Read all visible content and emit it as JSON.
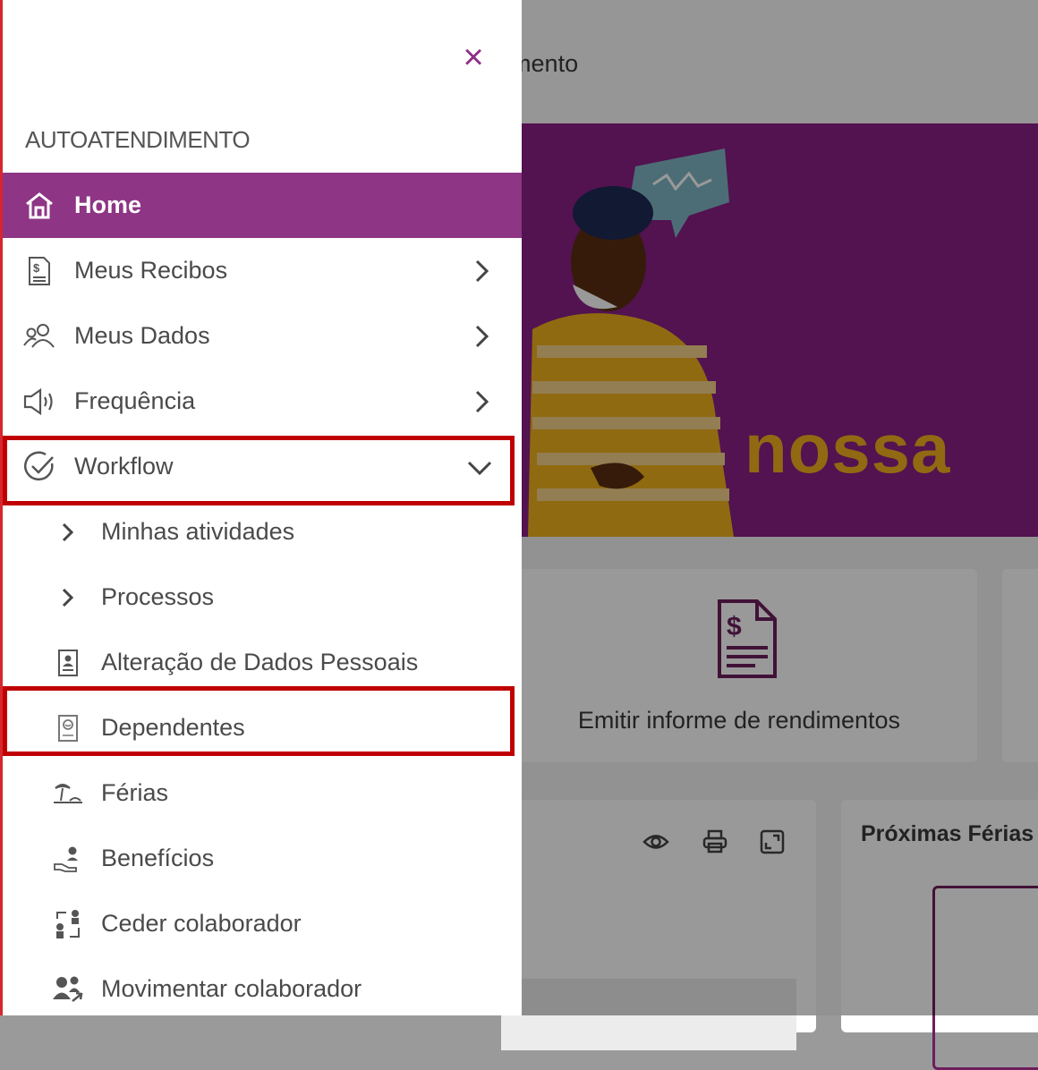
{
  "background": {
    "header_title": "endimento",
    "banner_text": "nossa",
    "card_label": "Emitir informe de rendimentos",
    "panel_title": "Próximas Férias",
    "tool_icons": [
      "eye-icon",
      "printer-icon",
      "expand-icon"
    ]
  },
  "drawer": {
    "close_label": "×",
    "section_title": "AUTOATENDIMENTO",
    "items": [
      {
        "label": "Home",
        "icon": "home-icon",
        "active": true
      },
      {
        "label": "Meus Recibos",
        "icon": "receipt-icon",
        "chevron": "right"
      },
      {
        "label": "Meus Dados",
        "icon": "people-icon",
        "chevron": "right"
      },
      {
        "label": "Frequência",
        "icon": "megaphone-icon",
        "chevron": "right"
      },
      {
        "label": "Workflow",
        "icon": "check-circle-icon",
        "chevron": "down",
        "highlighted": true
      }
    ],
    "sub_items": [
      {
        "label": "Minhas atividades",
        "icon": "chevron-right-icon"
      },
      {
        "label": "Processos",
        "icon": "chevron-right-icon"
      },
      {
        "label": "Alteração de Dados Pessoais",
        "icon": "id-card-icon"
      },
      {
        "label": "Dependentes",
        "icon": "dependents-icon",
        "highlighted": true
      },
      {
        "label": "Férias",
        "icon": "beach-icon"
      },
      {
        "label": "Benefícios",
        "icon": "benefits-icon"
      },
      {
        "label": "Ceder colaborador",
        "icon": "transfer-people-icon"
      },
      {
        "label": "Movimentar colaborador",
        "icon": "move-people-icon"
      }
    ]
  },
  "colors": {
    "accent": "#8e3585",
    "highlight": "#c00000",
    "banner": "#8a1f86",
    "banner_text": "#f2b01e"
  }
}
